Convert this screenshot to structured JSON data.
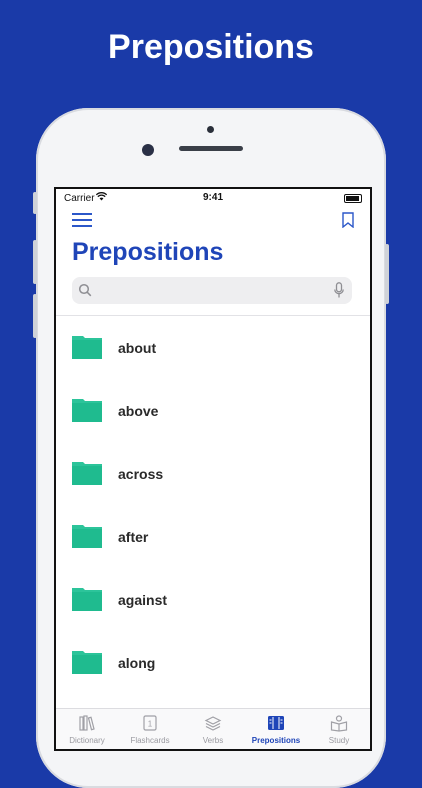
{
  "banner": {
    "headline": "Prepositions"
  },
  "status_bar": {
    "carrier": "Carrier",
    "time": "9:41"
  },
  "header": {
    "title": "Prepositions"
  },
  "search": {
    "placeholder": "",
    "value": ""
  },
  "list": {
    "items": [
      {
        "label": "about"
      },
      {
        "label": "above"
      },
      {
        "label": "across"
      },
      {
        "label": "after"
      },
      {
        "label": "against"
      },
      {
        "label": "along"
      }
    ]
  },
  "tabs": [
    {
      "label": "Dictionary",
      "icon": "books-icon"
    },
    {
      "label": "Flashcards",
      "icon": "flashcards-icon"
    },
    {
      "label": "Verbs",
      "icon": "stack-icon"
    },
    {
      "label": "Prepositions",
      "icon": "prepositions-icon",
      "active": true
    },
    {
      "label": "Study",
      "icon": "study-icon"
    }
  ],
  "colors": {
    "background": "#1a3aa8",
    "accent": "#1f45b8",
    "folder": "#2cc49a"
  }
}
